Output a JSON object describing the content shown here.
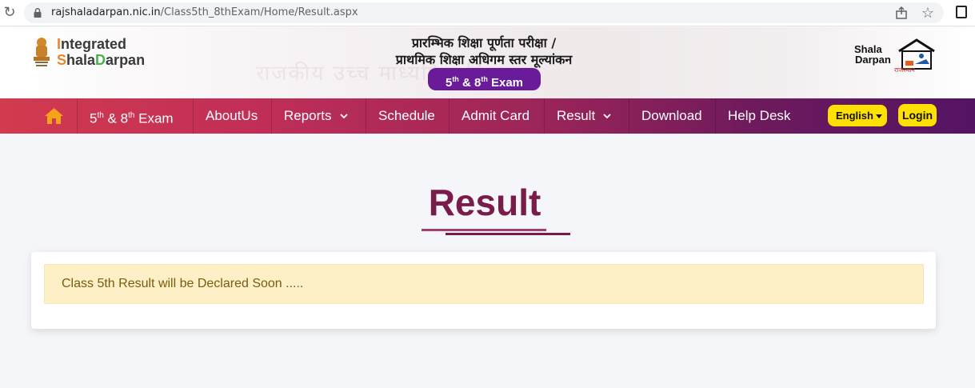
{
  "browser": {
    "url_host": "rajshaladarpan.nic.in",
    "url_path": "/Class5th_8thExam/Home/Result.aspx"
  },
  "header": {
    "brand_line1_first": "I",
    "brand_line1_rest": "ntegrated",
    "brand_line2_first": "S",
    "brand_line2_mid": "hala",
    "brand_line2_second": "D",
    "brand_line2_rest": "arpan",
    "hindi_title_line1": "प्रारम्भिक शिक्षा पूर्णता परीक्षा /",
    "hindi_title_line2": "प्राथमिक शिक्षा अधिगम स्तर मूल्यांकन",
    "exam_pill": {
      "a": "5",
      "a_sup": "th",
      "mid": " & 8",
      "b_sup": "th",
      "end": " Exam"
    },
    "logo_right_line1": "Shala",
    "logo_right_line2": "Darpan",
    "logo_right_sub": "राजस्थान",
    "background_text": "राजकीय उच्च माध्यमिक विद्यालय"
  },
  "nav": {
    "exam": {
      "a": "5",
      "a_sup": "th",
      "mid": " & 8",
      "b_sup": "th",
      "end": " Exam"
    },
    "about": "AboutUs",
    "reports": "Reports",
    "schedule": "Schedule",
    "admit_card": "Admit Card",
    "result": "Result",
    "download": "Download",
    "help_desk": "Help Desk",
    "language": "English",
    "login": "Login"
  },
  "main": {
    "title": "Result",
    "alert": "Class 5th Result will be Declared Soon ....."
  },
  "colors": {
    "nav_start": "#d23a4e",
    "nav_end": "#541464",
    "title": "#7a1c4a",
    "pill": "#6a1b9a",
    "button_yellow": "#ffe000",
    "alert_bg": "#fdf0c7"
  }
}
